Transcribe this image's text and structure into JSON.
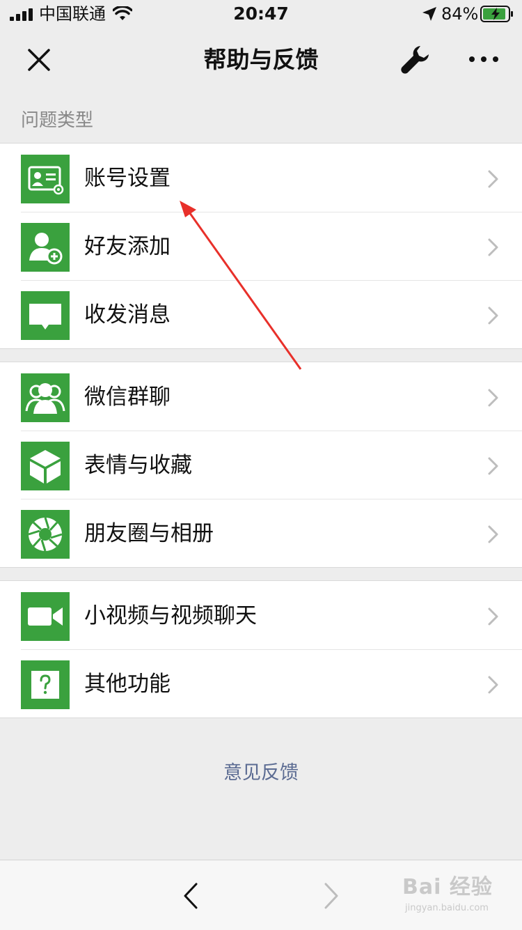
{
  "status_bar": {
    "carrier": "中国联通",
    "time": "20:47",
    "battery_percent": "84%",
    "signal_bars": 4,
    "icons": [
      "signal-icon",
      "wifi-icon",
      "location-icon",
      "battery-charging-icon"
    ]
  },
  "nav": {
    "title": "帮助与反馈",
    "icons": [
      "close-icon",
      "wrench-icon",
      "more-icon"
    ]
  },
  "section_label": "问题类型",
  "groups": [
    {
      "items": [
        {
          "label": "账号设置",
          "icon": "account-settings-icon"
        },
        {
          "label": "好友添加",
          "icon": "add-friend-icon"
        },
        {
          "label": "收发消息",
          "icon": "message-icon"
        }
      ]
    },
    {
      "items": [
        {
          "label": "微信群聊",
          "icon": "group-chat-icon"
        },
        {
          "label": "表情与收藏",
          "icon": "cube-icon"
        },
        {
          "label": "朋友圈与相册",
          "icon": "aperture-icon"
        }
      ]
    },
    {
      "items": [
        {
          "label": "小视频与视频聊天",
          "icon": "video-icon"
        },
        {
          "label": "其他功能",
          "icon": "question-icon"
        }
      ]
    }
  ],
  "feedback_link": "意见反馈",
  "toolbar": {
    "icons": [
      "back-icon",
      "forward-icon"
    ]
  },
  "watermark": {
    "brand": "Bai 经验",
    "sub": "jingyan.baidu.com"
  },
  "colors": {
    "accent_green": "#3aa13e",
    "link_blue": "#5b6b92",
    "annotation_red": "#e8302a"
  }
}
